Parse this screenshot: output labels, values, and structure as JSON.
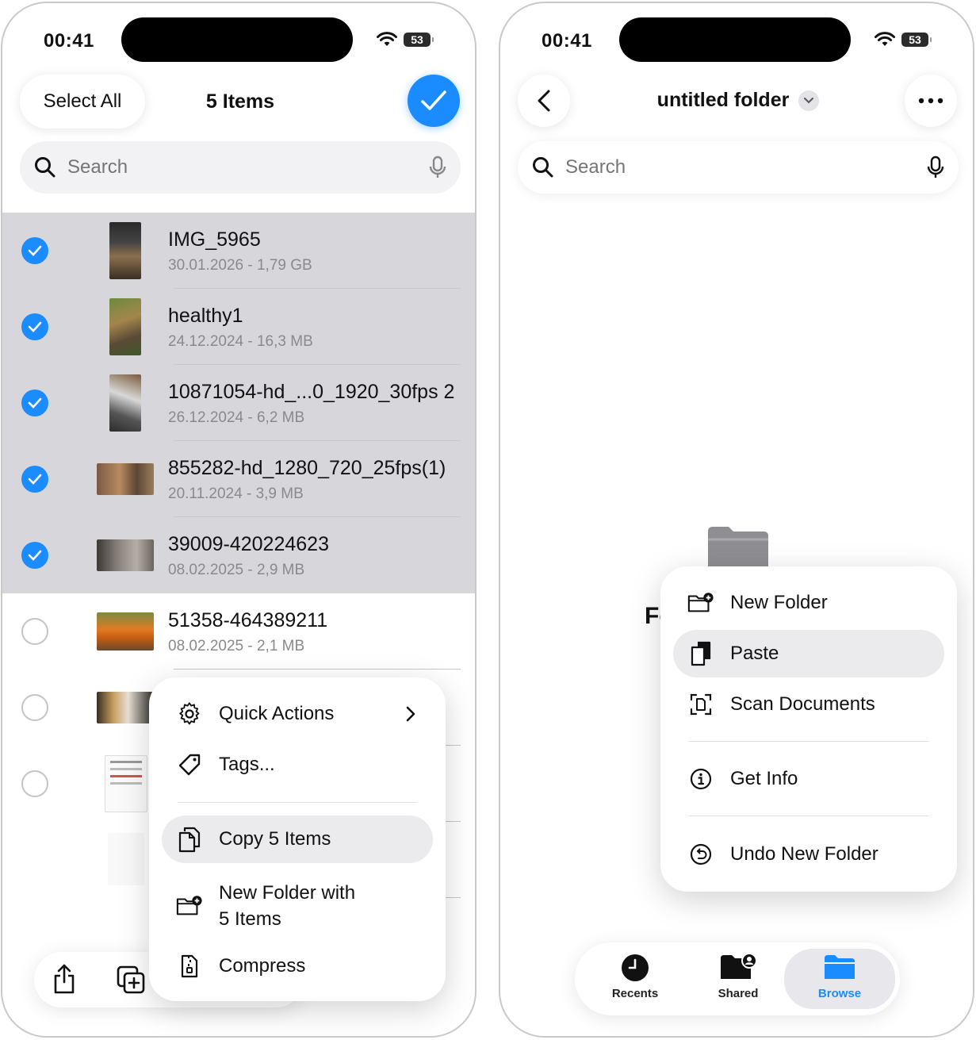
{
  "left": {
    "status": {
      "time": "00:41",
      "battery": "53"
    },
    "header": {
      "select_all_label": "Select All",
      "title": "5 Items"
    },
    "search": {
      "placeholder": "Search"
    },
    "files": [
      {
        "name": "IMG_5965",
        "meta": "30.01.2026 - 1,79 GB",
        "selected": true
      },
      {
        "name": "healthy1",
        "meta": "24.12.2024 - 16,3 MB",
        "selected": true
      },
      {
        "name": "10871054-hd_...0_1920_30fps 2",
        "meta": "26.12.2024 - 6,2 MB",
        "selected": true
      },
      {
        "name": "855282-hd_1280_720_25fps(1)",
        "meta": "20.11.2024 - 3,9 MB",
        "selected": true
      },
      {
        "name": "39009-420224623",
        "meta": "08.02.2025 - 2,9 MB",
        "selected": true
      },
      {
        "name": "51358-464389211",
        "meta": "08.02.2025 - 2,1 MB",
        "selected": false
      }
    ],
    "context_menu": {
      "quick_actions": "Quick Actions",
      "tags": "Tags...",
      "copy": "Copy 5 Items",
      "new_folder_line1": "New Folder with",
      "new_folder_line2": "5 Items",
      "compress": "Compress"
    }
  },
  "right": {
    "status": {
      "time": "00:41",
      "battery": "53"
    },
    "header": {
      "title": "untitled folder"
    },
    "search": {
      "placeholder": "Search"
    },
    "empty_label_fragment": "Fo",
    "context_menu": {
      "new_folder": "New Folder",
      "paste": "Paste",
      "scan_documents": "Scan Documents",
      "get_info": "Get Info",
      "undo_new_folder": "Undo New Folder"
    },
    "tabbar": {
      "recents": "Recents",
      "shared": "Shared",
      "browse": "Browse"
    }
  },
  "colors": {
    "accent": "#1a8cff",
    "selected_row": "#d6d6db",
    "text_secondary": "#8a8a8e"
  }
}
